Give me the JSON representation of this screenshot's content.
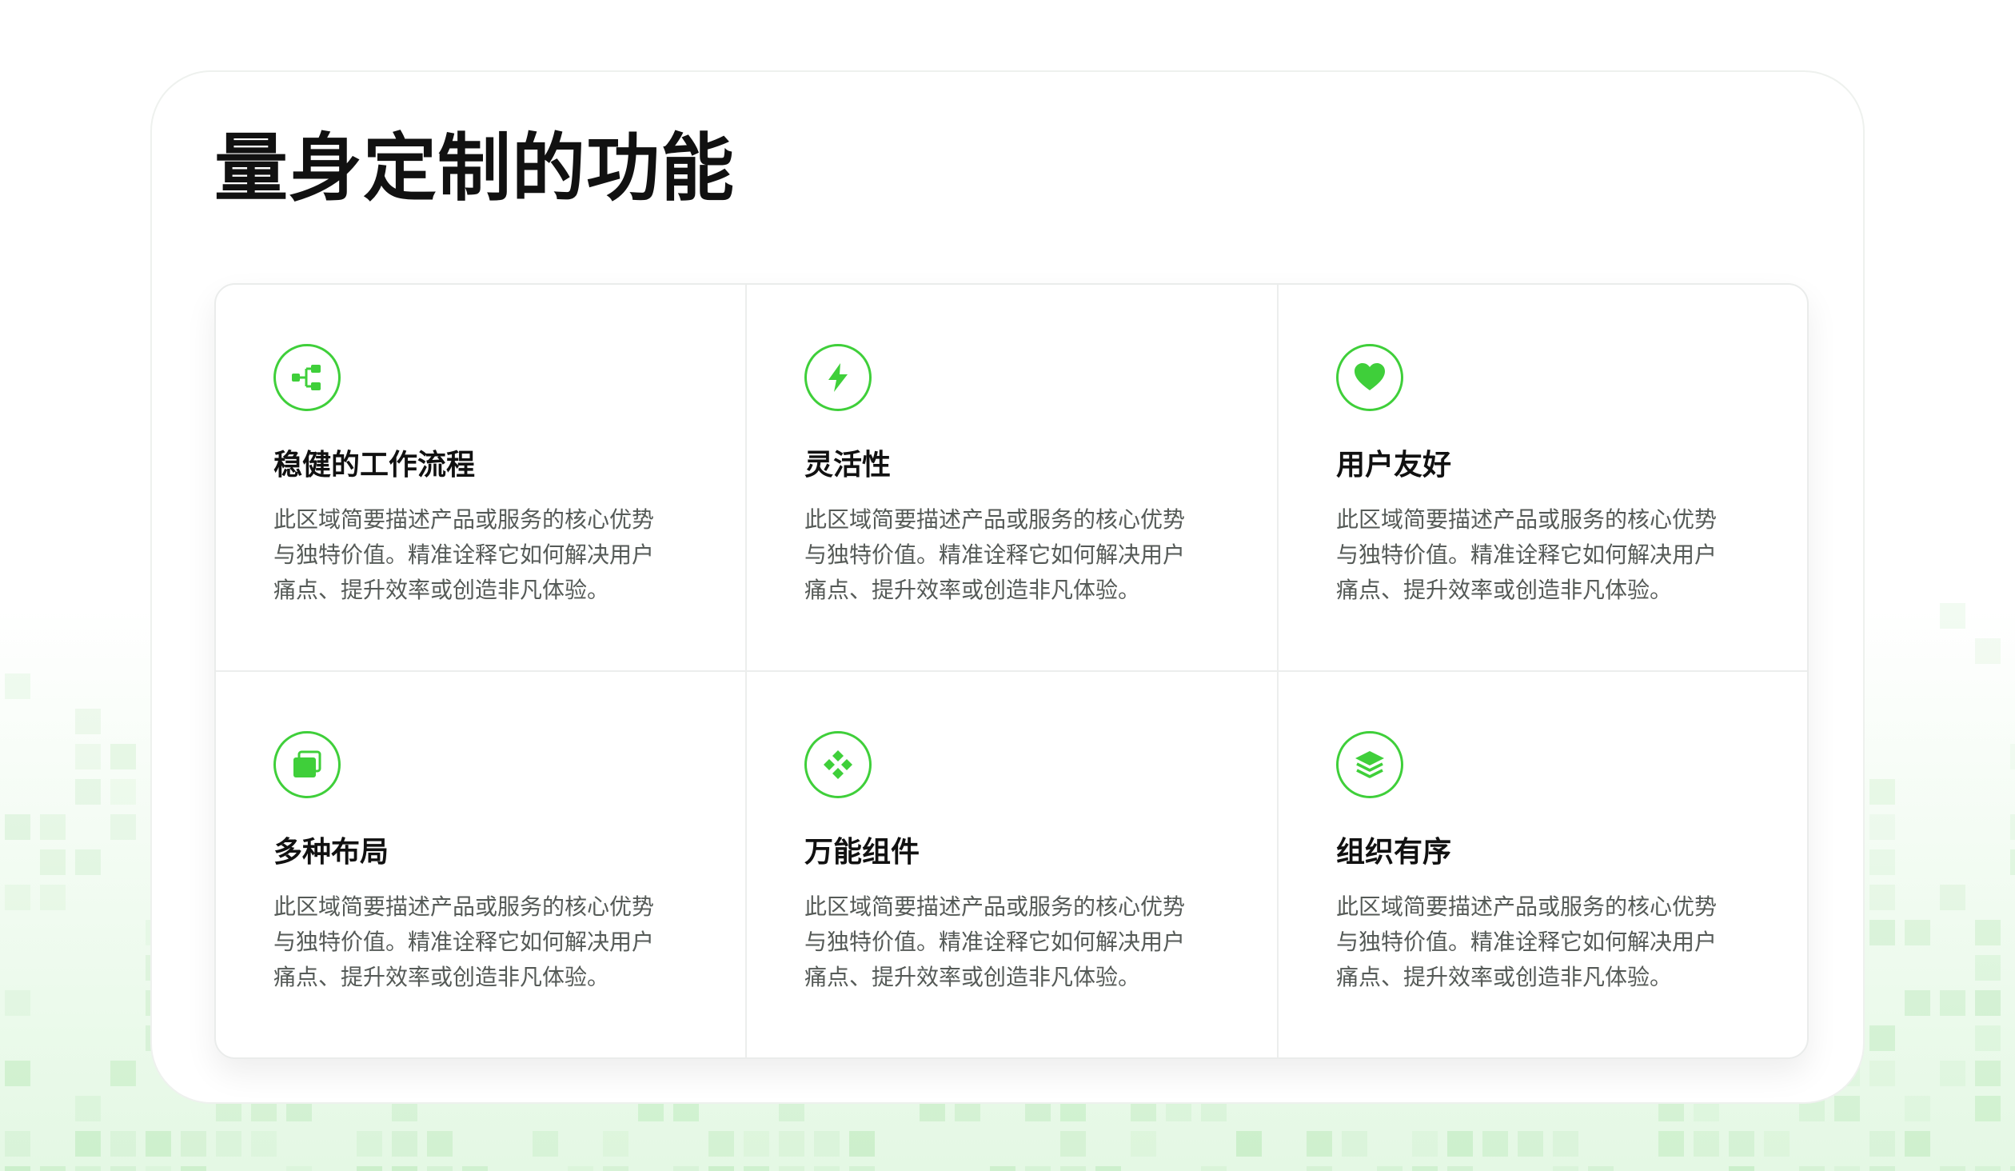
{
  "page": {
    "title": "量身定制的功能"
  },
  "theme": {
    "accent": "#3fcf3a",
    "title_color": "#111111",
    "text_color": "#555a57"
  },
  "features": [
    {
      "icon": "workflow-icon",
      "title": "稳健的工作流程",
      "description": "此区域简要描述产品或服务的核心优势与独特价值。精准诠释它如何解决用户痛点、提升效率或创造非凡体验。"
    },
    {
      "icon": "lightning-icon",
      "title": "灵活性",
      "description": "此区域简要描述产品或服务的核心优势与独特价值。精准诠释它如何解决用户痛点、提升效率或创造非凡体验。"
    },
    {
      "icon": "heart-icon",
      "title": "用户友好",
      "description": "此区域简要描述产品或服务的核心优势与独特价值。精准诠释它如何解决用户痛点、提升效率或创造非凡体验。"
    },
    {
      "icon": "layout-icon",
      "title": "多种布局",
      "description": "此区域简要描述产品或服务的核心优势与独特价值。精准诠释它如何解决用户痛点、提升效率或创造非凡体验。"
    },
    {
      "icon": "components-icon",
      "title": "万能组件",
      "description": "此区域简要描述产品或服务的核心优势与独特价值。精准诠释它如何解决用户痛点、提升效率或创造非凡体验。"
    },
    {
      "icon": "layers-icon",
      "title": "组织有序",
      "description": "此区域简要描述产品或服务的核心优势与独特价值。精准诠释它如何解决用户痛点、提升效率或创造非凡体验。"
    }
  ]
}
